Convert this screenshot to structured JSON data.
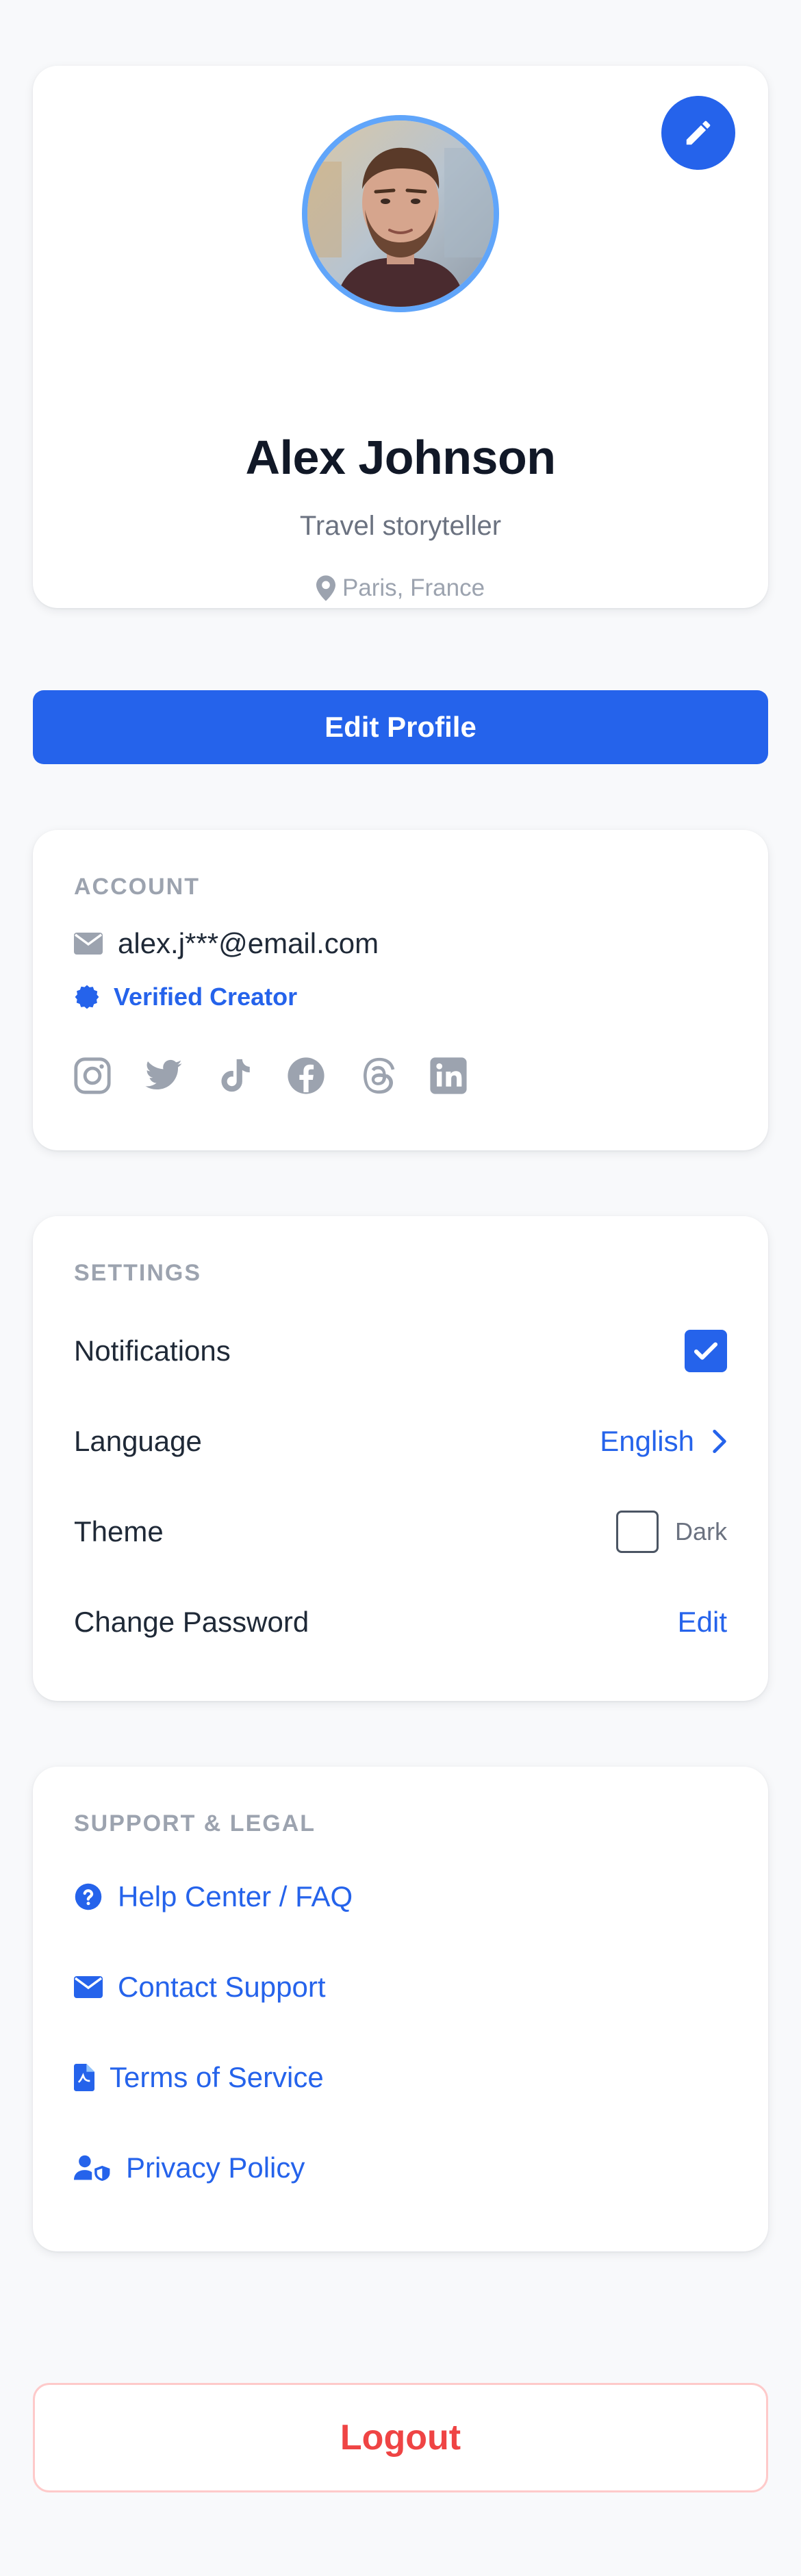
{
  "profile": {
    "name": "Alex Johnson",
    "tagline": "Travel storyteller",
    "location": "Paris, France"
  },
  "actions": {
    "edit_profile_label": "Edit Profile",
    "logout_label": "Logout"
  },
  "account": {
    "title": "ACCOUNT",
    "email": "alex.j***@email.com",
    "badge": "Verified Creator",
    "social": [
      "instagram-icon",
      "twitter-icon",
      "tiktok-icon",
      "facebook-icon",
      "threads-icon",
      "linkedin-icon"
    ]
  },
  "settings": {
    "title": "SETTINGS",
    "notifications_label": "Notifications",
    "notifications_enabled": true,
    "language_label": "Language",
    "language_value": "English",
    "theme_label": "Theme",
    "theme_option": "Dark",
    "theme_dark_enabled": false,
    "password_label": "Change Password",
    "password_action": "Edit"
  },
  "support": {
    "title": "SUPPORT & LEGAL",
    "items": [
      {
        "label": "Help Center / FAQ",
        "icon": "question-circle-icon"
      },
      {
        "label": "Contact Support",
        "icon": "envelope-icon"
      },
      {
        "label": "Terms of Service",
        "icon": "document-icon"
      },
      {
        "label": "Privacy Policy",
        "icon": "user-shield-icon"
      }
    ]
  },
  "colors": {
    "primary": "#2563eb",
    "avatar_ring": "#60a5fa",
    "danger": "#ef4444",
    "muted": "#9ca3af"
  }
}
